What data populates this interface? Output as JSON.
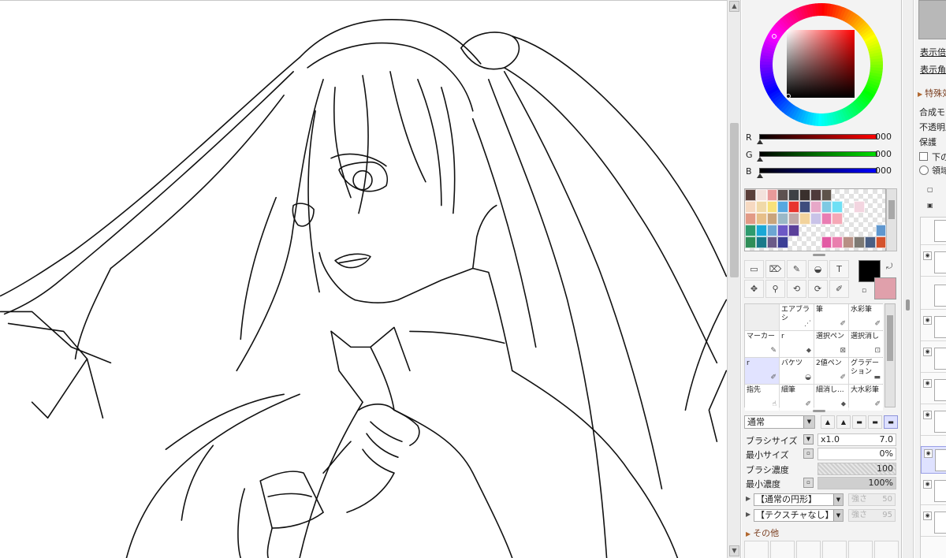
{
  "canvas": {
    "artwork": "line-art illustration"
  },
  "color": {
    "r_label": "R",
    "g_label": "G",
    "b_label": "B",
    "r_value": "000",
    "g_value": "000",
    "b_value": "000",
    "r_track": "#ff0000",
    "g_track": "#00e000",
    "b_track": "#0000ff",
    "main": "#000000",
    "sub": "#e0a0ab"
  },
  "palette": [
    "#5b3f3a",
    "#f3e1dc",
    "#e89a9a",
    "#5d5150",
    "#3d4145",
    "#3a302d",
    "#4f3a3a",
    "#5e534a",
    "",
    "",
    "",
    "",
    "",
    "#f6d9c1",
    "#f0d9a8",
    "#f7e17a",
    "#56a8e0",
    "#e8342e",
    "#3e4d7d",
    "#e7a8c8",
    "#7ec9e3",
    "#6ee0f5",
    "",
    "#f3d5e0",
    "",
    "",
    "#e29a86",
    "#e6bf89",
    "#c9a47b",
    "#9ab8c7",
    "#c0a8a8",
    "#f2d39c",
    "#c9c3e8",
    "#e97db3",
    "#f5a8b6",
    "",
    "",
    "",
    "",
    "#2e9b6e",
    "#1aa8d6",
    "#6da6d3",
    "#6c58c6",
    "#5a3f9a",
    "",
    "",
    "",
    "",
    "",
    "",
    "",
    "#5f97cf",
    "#2f8e58",
    "#197a8a",
    "#6b5a88",
    "#3b3f96",
    "",
    "",
    "",
    "#e25aa4",
    "#e97fae",
    "#b78f84",
    "#7e7a74",
    "#4a5f84",
    "#d4532d"
  ],
  "tools": {
    "row1": [
      "▭",
      "⌦",
      "✎",
      "◒",
      "T"
    ],
    "row2": [
      "✥",
      "⚲",
      "⟲",
      "⟳",
      "✐"
    ],
    "swap_icon": "⤾",
    "reset_icon": "▫"
  },
  "brushes": [
    {
      "name": "",
      "icon": "",
      "empty": true
    },
    {
      "name": "エアブラシ",
      "icon": "⋰"
    },
    {
      "name": "筆",
      "icon": "✐"
    },
    {
      "name": "水彩筆",
      "icon": "✐"
    },
    {
      "name": "マーカー",
      "icon": "✎"
    },
    {
      "name": "r",
      "icon": "⬥"
    },
    {
      "name": "選択ペン",
      "icon": "⊠"
    },
    {
      "name": "選択消し",
      "icon": "⊡"
    },
    {
      "name": "r",
      "icon": "✐",
      "selected": true
    },
    {
      "name": "バケツ",
      "icon": "◒"
    },
    {
      "name": "2値ペン",
      "icon": "✐"
    },
    {
      "name": "グラデーション",
      "icon": "▬"
    },
    {
      "name": "指先",
      "icon": "☝"
    },
    {
      "name": "細筆",
      "icon": "✐"
    },
    {
      "name": "細消し...",
      "icon": "⬥"
    },
    {
      "name": "大水彩筆",
      "icon": "✐"
    }
  ],
  "blend_mode": "通常",
  "shapes": [
    "▲",
    "▲",
    "▬",
    "▬",
    "▬"
  ],
  "props": {
    "brush_size_label": "ブラシサイズ",
    "brush_size_mult": "x1.0",
    "brush_size_value": "7.0",
    "min_size_label": "最小サイズ",
    "min_size_value": "0%",
    "density_label": "ブラシ濃度",
    "density_value": "100",
    "min_density_label": "最小濃度",
    "min_density_value": "100%"
  },
  "texture": {
    "shape_select": "【通常の円形】",
    "shape_strength_label": "強さ",
    "shape_strength_value": "50",
    "texture_select": "【テクスチャなし】",
    "texture_strength_label": "強さ",
    "texture_strength_value": "95"
  },
  "other_label": "その他",
  "right_panel": {
    "zoom_link": "表示倍率",
    "angle_link": "表示角度",
    "special_header": "特殊効果",
    "blend_label": "合成モード",
    "opacity_label": "不透明度",
    "protect_label": "保護",
    "below_label": "下のレイヤーでクリッピング",
    "region_label": "領域"
  }
}
